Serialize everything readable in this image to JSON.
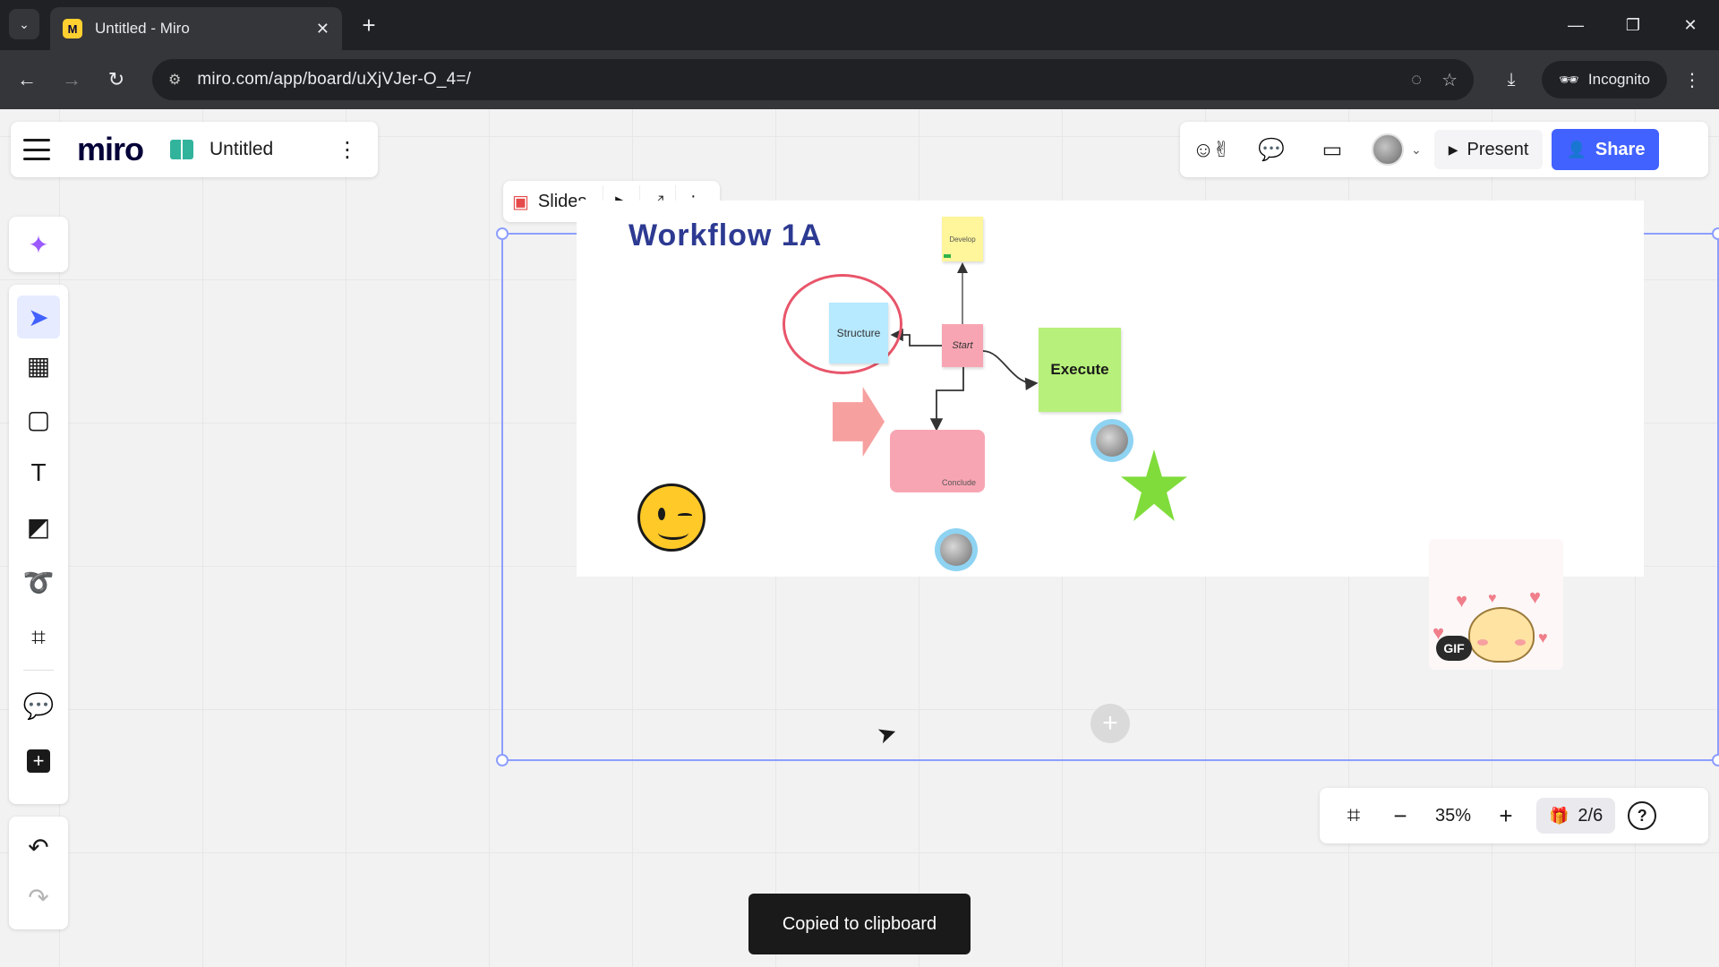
{
  "browser": {
    "tab_title": "Untitled - Miro",
    "favicon_letter": "M",
    "url": "miro.com/app/board/uXjVJer-O_4=/",
    "incognito_label": "Incognito",
    "icons": {
      "tab_list": "chevron-down-icon",
      "close_tab": "close-icon",
      "new_tab": "plus-icon",
      "back": "arrow-left-icon",
      "forward": "arrow-right-icon",
      "reload": "reload-icon",
      "site_info": "tune-icon",
      "eye_off": "eye-off-icon",
      "bookmark": "star-icon",
      "download": "download-icon",
      "menu": "kebab-icon"
    }
  },
  "board": {
    "logo": "miro",
    "name": "Untitled"
  },
  "header_right": {
    "present_label": "Present",
    "share_label": "Share",
    "brand_color": "#4262ff"
  },
  "slides_bar": {
    "label": "Slides"
  },
  "content": {
    "workflow_title": "Workflow 1A",
    "stickies": {
      "develop": "Develop",
      "structure": "Structure",
      "start": "Start",
      "execute": "Execute",
      "conclude": "Conclude"
    },
    "gif_badge": "GIF"
  },
  "toast": {
    "message": "Copied to clipboard"
  },
  "zoom": {
    "level": "35%",
    "slides_count": "2/6"
  },
  "colors": {
    "sticky_yellow": "#fff59a",
    "sticky_blue": "#b7e9ff",
    "sticky_pink": "#f8a5b3",
    "sticky_green": "#b7f07a",
    "title_navy": "#2d3a92",
    "selection_blue": "#8d9eff"
  }
}
